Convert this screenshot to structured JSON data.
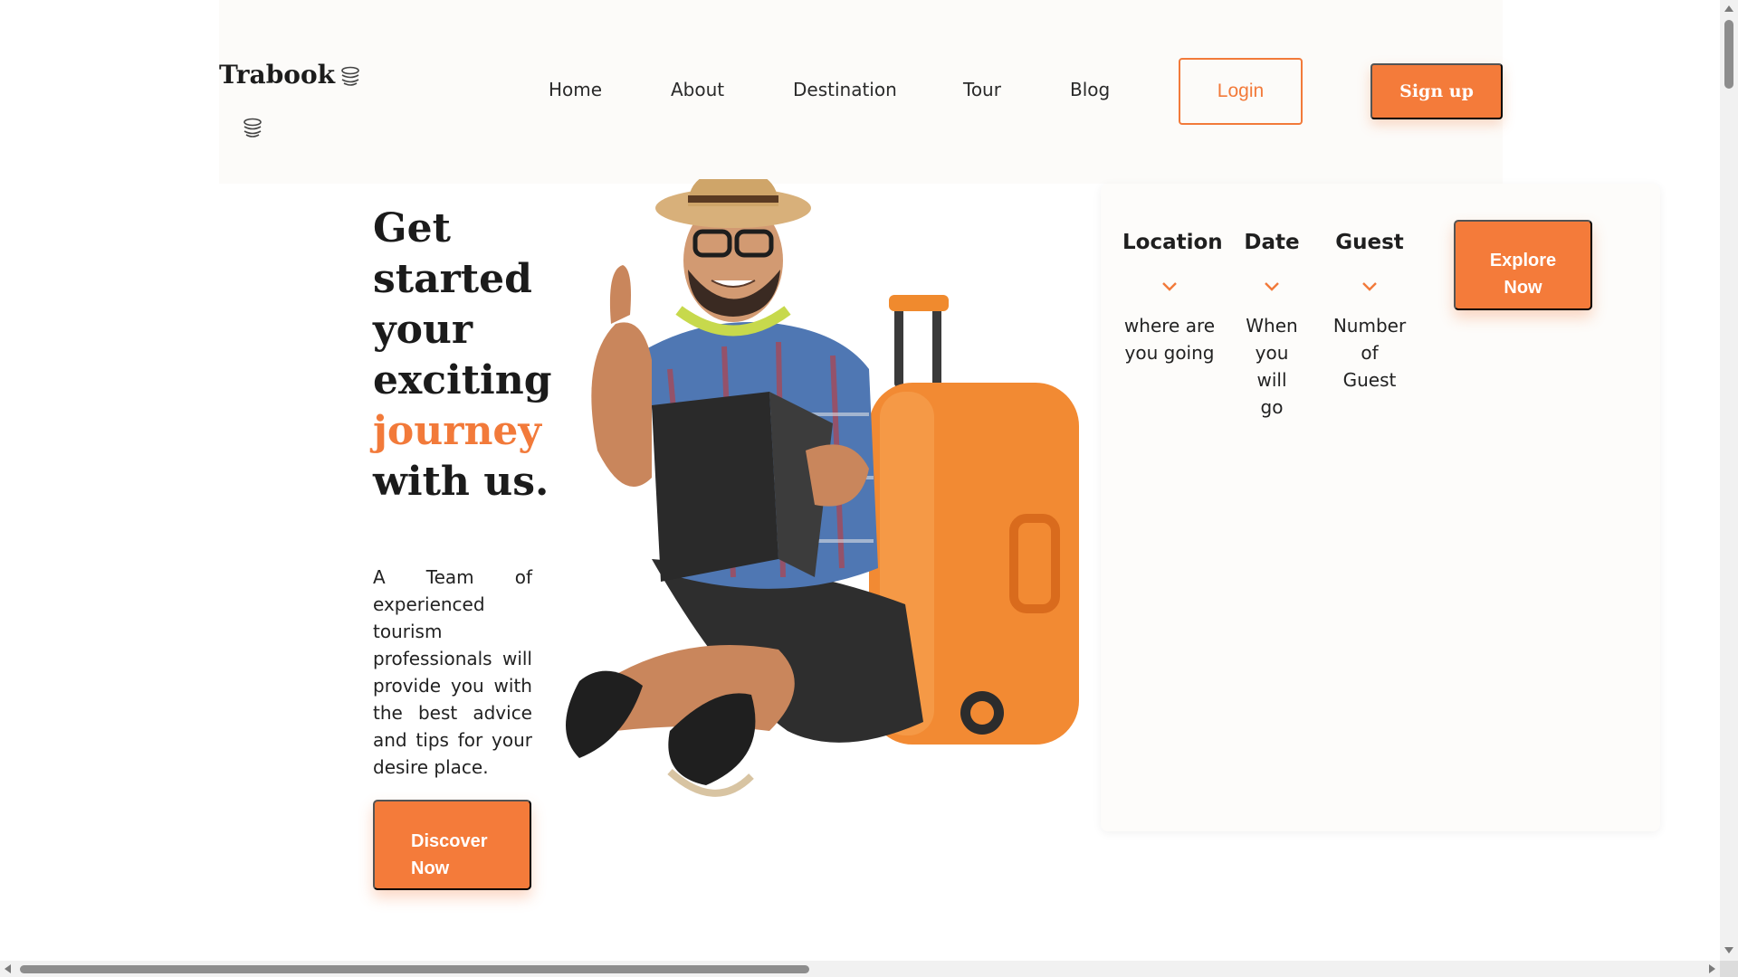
{
  "brand": {
    "name": "Trabook",
    "logo_icon": "stacked-coins-icon"
  },
  "nav": {
    "links": [
      "Home",
      "About",
      "Destination",
      "Tour",
      "Blog"
    ],
    "login_label": "Login",
    "signup_label": "Sign up"
  },
  "hero": {
    "title_line1": "Get",
    "title_line2": "started",
    "title_line3": "your",
    "title_line4": "exciting",
    "title_accent": "journey",
    "title_line6": "with us.",
    "description": "A Team of experienced tourism professionals will provide you with the best advice and tips for your desire place.",
    "cta_line1": "Discover",
    "cta_line2": "Now",
    "illustration": "traveler-with-suitcase-image"
  },
  "search": {
    "fields": [
      {
        "label": "Location",
        "hint_lines": [
          "where are",
          "you going"
        ],
        "icon": "chevron-down-icon"
      },
      {
        "label": "Date",
        "hint_lines": [
          "When",
          "you",
          "will",
          "go"
        ],
        "icon": "chevron-down-icon"
      },
      {
        "label": "Guest",
        "hint_lines": [
          "Number",
          "of",
          "Guest"
        ],
        "icon": "chevron-down-icon"
      }
    ],
    "explore_line1": "Explore",
    "explore_line2": "Now"
  },
  "colors": {
    "accent": "#f47b3a",
    "text": "#1f1f1f",
    "header_bg": "#fcfbf9"
  }
}
